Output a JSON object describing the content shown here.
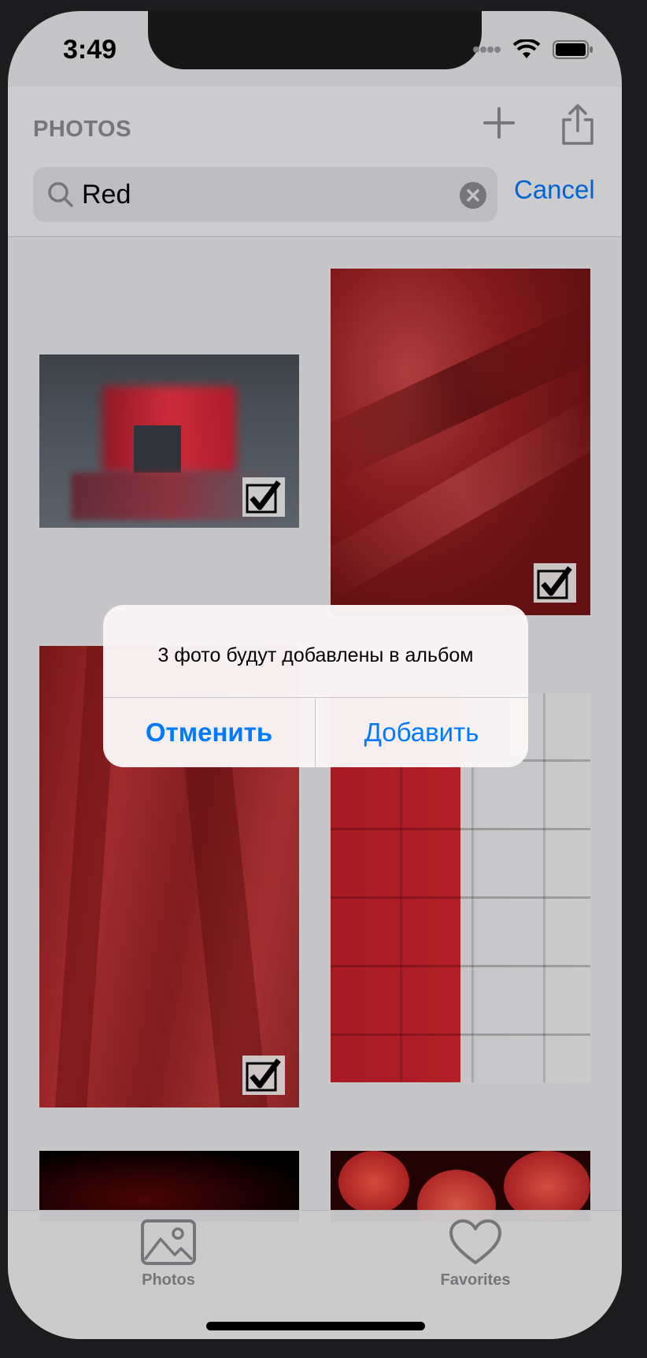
{
  "status": {
    "time": "3:49"
  },
  "nav": {
    "title": "PHOTOS",
    "add_icon": "plus-icon",
    "share_icon": "share-icon"
  },
  "search": {
    "value": "Red",
    "cancel_label": "Cancel"
  },
  "photos": [
    {
      "desc": "red-reflection",
      "selected": true
    },
    {
      "desc": "red-silk",
      "selected": true
    },
    {
      "desc": "red-leaves",
      "selected": true
    },
    {
      "desc": "red-white-brick-wall",
      "selected": false
    },
    {
      "desc": "dark-red-sparks",
      "selected": false
    },
    {
      "desc": "red-lanterns",
      "selected": false
    }
  ],
  "alert": {
    "message": "3 фото будут добавлены в альбом",
    "cancel_label": "Отменить",
    "confirm_label": "Добавить"
  },
  "tabbar": {
    "items": [
      {
        "label": "Photos",
        "icon": "photo-icon"
      },
      {
        "label": "Favorites",
        "icon": "heart-icon"
      }
    ]
  },
  "colors": {
    "accent": "#007aff"
  }
}
